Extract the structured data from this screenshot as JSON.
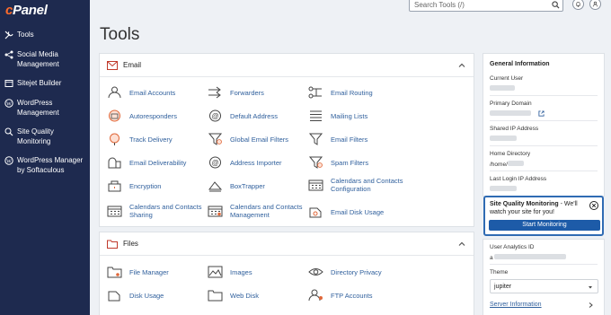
{
  "brand": {
    "logo_c": "c",
    "logo_rest": "Panel"
  },
  "sidebar": {
    "items": [
      {
        "label": "Tools",
        "icon": "wrench-icon"
      },
      {
        "label": "Social Media Management",
        "icon": "share-icon"
      },
      {
        "label": "Sitejet Builder",
        "icon": "builder-icon"
      },
      {
        "label": "WordPress Management",
        "icon": "wordpress-icon"
      },
      {
        "label": "Site Quality Monitoring",
        "icon": "monitor-icon"
      },
      {
        "label": "WordPress Manager by Softaculous",
        "icon": "wordpress-icon"
      }
    ]
  },
  "topbar": {
    "search_placeholder": "Search Tools (/)"
  },
  "page": {
    "title": "Tools"
  },
  "email_section": {
    "title": "Email",
    "tools": [
      "Email Accounts",
      "Forwarders",
      "Email Routing",
      "Autoresponders",
      "Default Address",
      "Mailing Lists",
      "Track Delivery",
      "Global Email Filters",
      "Email Filters",
      "Email Deliverability",
      "Address Importer",
      "Spam Filters",
      "Encryption",
      "BoxTrapper",
      "Calendars and Contacts Configuration",
      "Calendars and Contacts Sharing",
      "Calendars and Contacts Management",
      "Email Disk Usage"
    ]
  },
  "files_section": {
    "title": "Files",
    "tools": [
      "File Manager",
      "Images",
      "Directory Privacy",
      "Disk Usage",
      "Web Disk",
      "FTP Accounts"
    ]
  },
  "general_info": {
    "title": "General Information",
    "current_user_label": "Current User",
    "primary_domain_label": "Primary Domain",
    "shared_ip_label": "Shared IP Address",
    "home_dir_label": "Home Directory",
    "home_dir_value": "/home/",
    "last_login_label": "Last Login IP Address"
  },
  "sqm_popup": {
    "title": "Site Quality Monitoring",
    "text": " - We'll watch your site for you!",
    "button": "Start Monitoring"
  },
  "lower_info": {
    "analytics_label": "User Analytics ID",
    "analytics_prefix": "a",
    "theme_label": "Theme",
    "theme_value": "jupiter",
    "server_info": "Server Information"
  },
  "colors": {
    "sidebar": "#1e2a4f",
    "accent": "#ff6c2c",
    "link": "#2f5f9c",
    "button": "#1d5ba8"
  }
}
